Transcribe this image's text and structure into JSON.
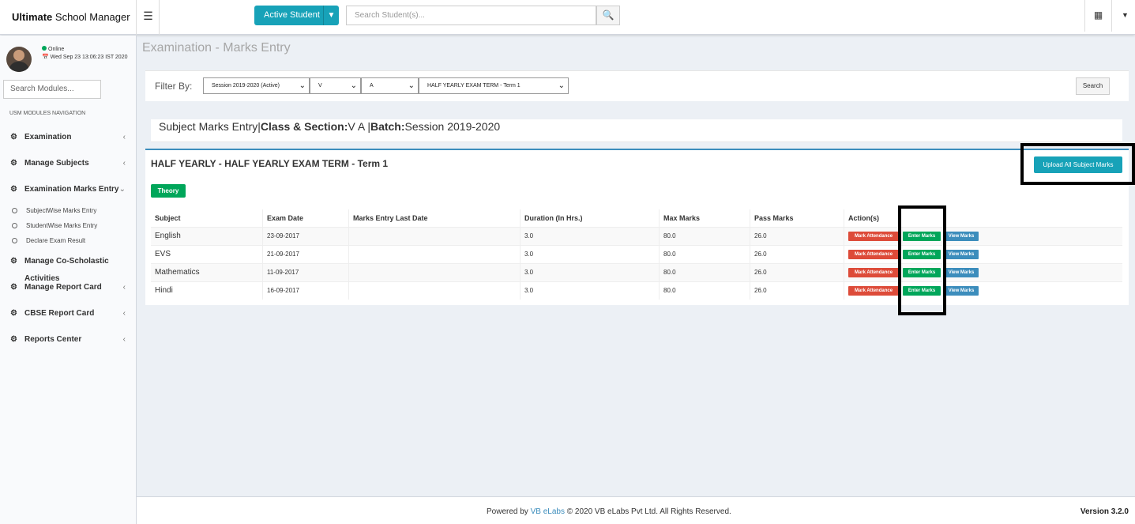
{
  "app": {
    "brand_bold": "Ultimate",
    "brand_rest": " School Manager"
  },
  "topbar": {
    "active_label": "Active Student",
    "search_placeholder": "Search Student(s)..."
  },
  "user": {
    "status": "Online",
    "datetime": "Wed Sep 23 13:06:23 IST 2020"
  },
  "sidebar": {
    "module_search_placeholder": "Search Modules...",
    "header": "USM MODULES NAVIGATION",
    "items": [
      {
        "label": "Examination",
        "chev": "‹"
      },
      {
        "label": "Manage Subjects",
        "chev": "‹"
      },
      {
        "label": "Examination Marks Entry",
        "chev": "⌄"
      },
      {
        "label": "Manage Co-Scholastic Activities",
        "chev": ""
      },
      {
        "label": "Manage Report Card",
        "chev": "‹"
      },
      {
        "label": "CBSE Report Card",
        "chev": "‹"
      },
      {
        "label": "Reports Center",
        "chev": "‹"
      }
    ],
    "sub_items": [
      "SubjectWise Marks Entry",
      "StudentWise Marks Entry",
      "Declare Exam Result"
    ]
  },
  "page": {
    "title": "Examination - Marks Entry"
  },
  "filter": {
    "label": "Filter By:",
    "session": "Session 2019-2020 (Active)",
    "class": "V",
    "section": "A",
    "exam": "HALF YEARLY EXAM TERM - Term 1",
    "search_label": "Search"
  },
  "info": {
    "prefix": "Subject Marks Entry",
    "class_label": "Class & Section:",
    "class_value": "V A ",
    "batch_label": "Batch:",
    "batch_value": "Session 2019-2020"
  },
  "exam": {
    "title": "HALF YEARLY - HALF YEARLY EXAM TERM - Term 1",
    "upload_label": "Upload All Subject Marks",
    "type_badge": "Theory"
  },
  "table": {
    "headers": [
      "Subject",
      "Exam Date",
      "Marks Entry Last Date",
      "Duration (In Hrs.)",
      "Max Marks",
      "Pass Marks",
      "Action(s)"
    ],
    "rows": [
      {
        "subject": "English",
        "exam_date": "23-09-2017",
        "last_date": "",
        "duration": "3.0",
        "max": "80.0",
        "pass": "26.0"
      },
      {
        "subject": "EVS",
        "exam_date": "21-09-2017",
        "last_date": "",
        "duration": "3.0",
        "max": "80.0",
        "pass": "26.0"
      },
      {
        "subject": "Mathematics",
        "exam_date": "11-09-2017",
        "last_date": "",
        "duration": "3.0",
        "max": "80.0",
        "pass": "26.0"
      },
      {
        "subject": "Hindi",
        "exam_date": "16-09-2017",
        "last_date": "",
        "duration": "3.0",
        "max": "80.0",
        "pass": "26.0"
      }
    ],
    "actions": {
      "attendance": "Mark Attendance",
      "enter": "Enter Marks",
      "view": "View Marks"
    }
  },
  "footer": {
    "powered": "Powered by ",
    "link": "VB eLabs",
    "rest": " © 2020 VB eLabs Pvt Ltd. All Rights Reserved.",
    "version": "Version 3.2.0"
  },
  "colors": {
    "accent": "#17a2b8",
    "success": "#00a65a",
    "danger": "#dd4b39",
    "primary": "#3c8dbc"
  }
}
